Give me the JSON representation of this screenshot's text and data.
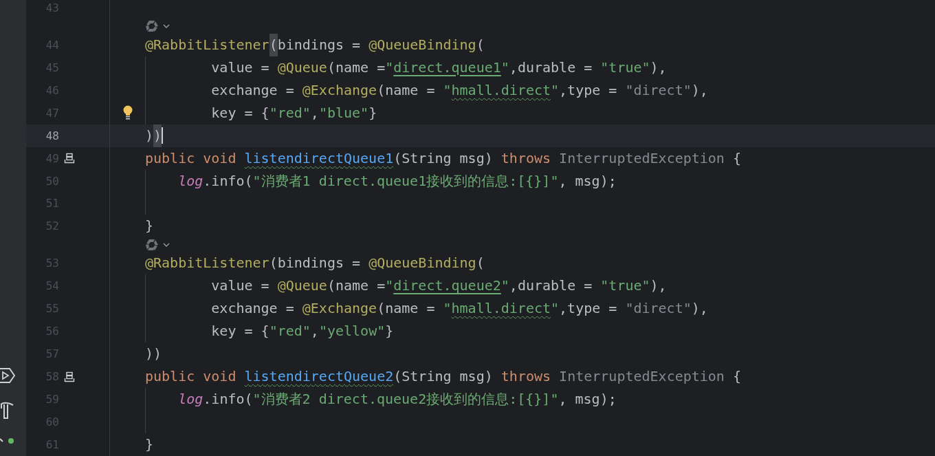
{
  "editor": {
    "lines": [
      {
        "kind": "code",
        "number": "43"
      },
      {
        "kind": "hint"
      },
      {
        "kind": "code",
        "number": "44",
        "tokens": [
          {
            "text": "@RabbitListener",
            "kind": "annotation"
          },
          {
            "text": "(",
            "kind": "plain",
            "matched": true
          },
          {
            "text": "bindings = ",
            "kind": "plain"
          },
          {
            "text": "@QueueBinding",
            "kind": "annotation"
          },
          {
            "text": "(",
            "kind": "plain"
          }
        ]
      },
      {
        "kind": "code",
        "number": "45",
        "guide": true,
        "tokens": [
          {
            "text": "        value = ",
            "kind": "plain"
          },
          {
            "text": "@Queue",
            "kind": "annotation"
          },
          {
            "text": "(name =",
            "kind": "plain"
          },
          {
            "text": "\"",
            "kind": "string"
          },
          {
            "text": "direct.queue1",
            "kind": "reference"
          },
          {
            "text": "\"",
            "kind": "string"
          },
          {
            "text": ",durable = ",
            "kind": "plain"
          },
          {
            "text": "\"true\"",
            "kind": "string"
          },
          {
            "text": "),",
            "kind": "plain"
          }
        ]
      },
      {
        "kind": "code",
        "number": "46",
        "guide": true,
        "tokens": [
          {
            "text": "        exchange = ",
            "kind": "plain"
          },
          {
            "text": "@Exchange",
            "kind": "annotation"
          },
          {
            "text": "(name = ",
            "kind": "plain"
          },
          {
            "text": "\"",
            "kind": "string"
          },
          {
            "text": "hmall.direct",
            "kind": "typo"
          },
          {
            "text": "\"",
            "kind": "string"
          },
          {
            "text": ",type = ",
            "kind": "plain"
          },
          {
            "text": "\"direct\"",
            "kind": "muted"
          },
          {
            "text": "),",
            "kind": "plain"
          }
        ]
      },
      {
        "kind": "code",
        "number": "47",
        "guide": true,
        "gutter_icon": {
          "kind": "intention"
        },
        "tokens": [
          {
            "text": "        key = {",
            "kind": "plain"
          },
          {
            "text": "\"red\"",
            "kind": "string"
          },
          {
            "text": ",",
            "kind": "plain"
          },
          {
            "text": "\"blue\"",
            "kind": "string"
          },
          {
            "text": "}",
            "kind": "plain"
          }
        ]
      },
      {
        "kind": "code",
        "number": "48",
        "current": true,
        "tokens": [
          {
            "text": ")",
            "kind": "plain"
          },
          {
            "text": ")",
            "kind": "plain",
            "matched": true
          }
        ]
      },
      {
        "kind": "code",
        "number": "49",
        "gutter_icon": {
          "kind": "bean"
        },
        "tokens": [
          {
            "text": "public void ",
            "kind": "keyword"
          },
          {
            "text": "listendirectQueue1",
            "kind": "method"
          },
          {
            "text": "(String msg) ",
            "kind": "plain"
          },
          {
            "text": "throws ",
            "kind": "keyword"
          },
          {
            "text": "InterruptedException",
            "kind": "muted"
          },
          {
            "text": " {",
            "kind": "plain"
          }
        ]
      },
      {
        "kind": "code",
        "number": "50",
        "guide": true,
        "tokens": [
          {
            "text": "    log",
            "kind": "field"
          },
          {
            "text": ".info(",
            "kind": "plain"
          },
          {
            "text": "\"消费者1 direct.queue1接收到的信息:[{}]\"",
            "kind": "string"
          },
          {
            "text": ", msg);",
            "kind": "plain"
          }
        ]
      },
      {
        "kind": "code",
        "number": "51",
        "guide": true
      },
      {
        "kind": "code",
        "number": "52",
        "tokens": [
          {
            "text": "}",
            "kind": "plain"
          }
        ]
      },
      {
        "kind": "hint"
      },
      {
        "kind": "code",
        "number": "53",
        "tokens": [
          {
            "text": "@RabbitListener",
            "kind": "annotation"
          },
          {
            "text": "(bindings = ",
            "kind": "plain"
          },
          {
            "text": "@QueueBinding",
            "kind": "annotation"
          },
          {
            "text": "(",
            "kind": "plain"
          }
        ]
      },
      {
        "kind": "code",
        "number": "54",
        "guide": true,
        "tokens": [
          {
            "text": "        value = ",
            "kind": "plain"
          },
          {
            "text": "@Queue",
            "kind": "annotation"
          },
          {
            "text": "(name =",
            "kind": "plain"
          },
          {
            "text": "\"",
            "kind": "string"
          },
          {
            "text": "direct.queue2",
            "kind": "reference"
          },
          {
            "text": "\"",
            "kind": "string"
          },
          {
            "text": ",durable = ",
            "kind": "plain"
          },
          {
            "text": "\"true\"",
            "kind": "string"
          },
          {
            "text": "),",
            "kind": "plain"
          }
        ]
      },
      {
        "kind": "code",
        "number": "55",
        "guide": true,
        "tokens": [
          {
            "text": "        exchange = ",
            "kind": "plain"
          },
          {
            "text": "@Exchange",
            "kind": "annotation"
          },
          {
            "text": "(name = ",
            "kind": "plain"
          },
          {
            "text": "\"",
            "kind": "string"
          },
          {
            "text": "hmall.direct",
            "kind": "typo"
          },
          {
            "text": "\"",
            "kind": "string"
          },
          {
            "text": ",type = ",
            "kind": "plain"
          },
          {
            "text": "\"direct\"",
            "kind": "muted"
          },
          {
            "text": "),",
            "kind": "plain"
          }
        ]
      },
      {
        "kind": "code",
        "number": "56",
        "guide": true,
        "tokens": [
          {
            "text": "        key = {",
            "kind": "plain"
          },
          {
            "text": "\"red\"",
            "kind": "string"
          },
          {
            "text": ",",
            "kind": "plain"
          },
          {
            "text": "\"yellow\"",
            "kind": "string"
          },
          {
            "text": "}",
            "kind": "plain"
          }
        ]
      },
      {
        "kind": "code",
        "number": "57",
        "tokens": [
          {
            "text": "))",
            "kind": "plain"
          }
        ]
      },
      {
        "kind": "code",
        "number": "58",
        "gutter_icon": {
          "kind": "bean"
        },
        "tokens": [
          {
            "text": "public void ",
            "kind": "keyword"
          },
          {
            "text": "listendirectQueue2",
            "kind": "method"
          },
          {
            "text": "(String msg) ",
            "kind": "plain"
          },
          {
            "text": "throws ",
            "kind": "keyword"
          },
          {
            "text": "InterruptedException",
            "kind": "muted"
          },
          {
            "text": " {",
            "kind": "plain"
          }
        ]
      },
      {
        "kind": "code",
        "number": "59",
        "guide": true,
        "tokens": [
          {
            "text": "    log",
            "kind": "field"
          },
          {
            "text": ".info(",
            "kind": "plain"
          },
          {
            "text": "\"消费者2 direct.queue2接收到的信息:[{}]\"",
            "kind": "string"
          },
          {
            "text": ", msg);",
            "kind": "plain"
          }
        ]
      },
      {
        "kind": "code",
        "number": "60",
        "guide": true
      },
      {
        "kind": "code",
        "number": "61",
        "tokens": [
          {
            "text": "}",
            "kind": "plain"
          }
        ]
      }
    ]
  }
}
